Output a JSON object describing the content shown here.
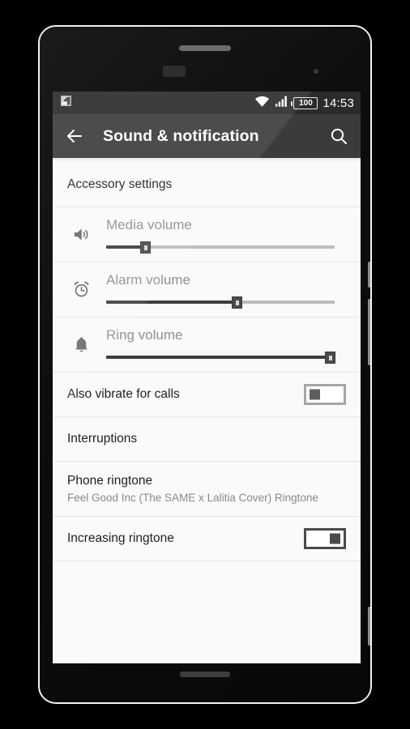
{
  "device": {
    "name": "android-phone-mockup",
    "bezel_color": "#f2f2f2",
    "body_color": "#0a0a0a"
  },
  "status_bar": {
    "background": "#2b2b2b",
    "notification_icon": "app-notification-icon",
    "wifi_icon": "wifi-icon",
    "signal_icon": "cellular-signal-icon",
    "battery_icon": "battery-icon",
    "battery_level": "100",
    "clock": "14:53"
  },
  "app_bar": {
    "background": "#3b3b3b",
    "back_icon": "back-arrow-icon",
    "title": "Sound & notification",
    "search_icon": "search-icon"
  },
  "settings_list": [
    {
      "type": "simple",
      "name": "accessory-settings",
      "title": "Accessory settings"
    },
    {
      "type": "slider",
      "name": "media-volume",
      "icon": "speaker-icon",
      "label": "Media volume",
      "value": 17,
      "min": 0,
      "max": 100
    },
    {
      "type": "slider",
      "name": "alarm-volume",
      "icon": "alarm-clock-icon",
      "label": "Alarm volume",
      "value": 57,
      "min": 0,
      "max": 100
    },
    {
      "type": "slider",
      "name": "ring-volume",
      "icon": "bell-icon",
      "label": "Ring volume",
      "value": 98,
      "min": 0,
      "max": 100
    },
    {
      "type": "toggle",
      "name": "also-vibrate-for-calls",
      "title": "Also vibrate for calls",
      "state": "off"
    },
    {
      "type": "simple",
      "name": "interruptions",
      "title": "Interruptions"
    },
    {
      "type": "two_line",
      "name": "phone-ringtone",
      "title": "Phone ringtone",
      "subtitle": "Feel Good Inc (The SAME x Lalitia Cover) Ringtone"
    },
    {
      "type": "toggle",
      "name": "increasing-ringtone",
      "title": "Increasing ringtone",
      "state": "on"
    }
  ],
  "nav_bar": {
    "background": "#353535",
    "buttons": [
      {
        "name": "nav-back",
        "icon": "back-diagonal-arrow-icon"
      },
      {
        "name": "nav-home",
        "icon": "home-square-icon"
      },
      {
        "name": "nav-recents",
        "icon": "recents-square-icon"
      }
    ]
  },
  "colors": {
    "screen_background": "#fafafa",
    "divider": "#e6e6e6",
    "primary_text": "#1f1f1f",
    "secondary_text": "#8a8a8a",
    "slider_label": "#909090",
    "slider_fill": "#3d3d3d",
    "slider_track": "#bdbdbd"
  }
}
